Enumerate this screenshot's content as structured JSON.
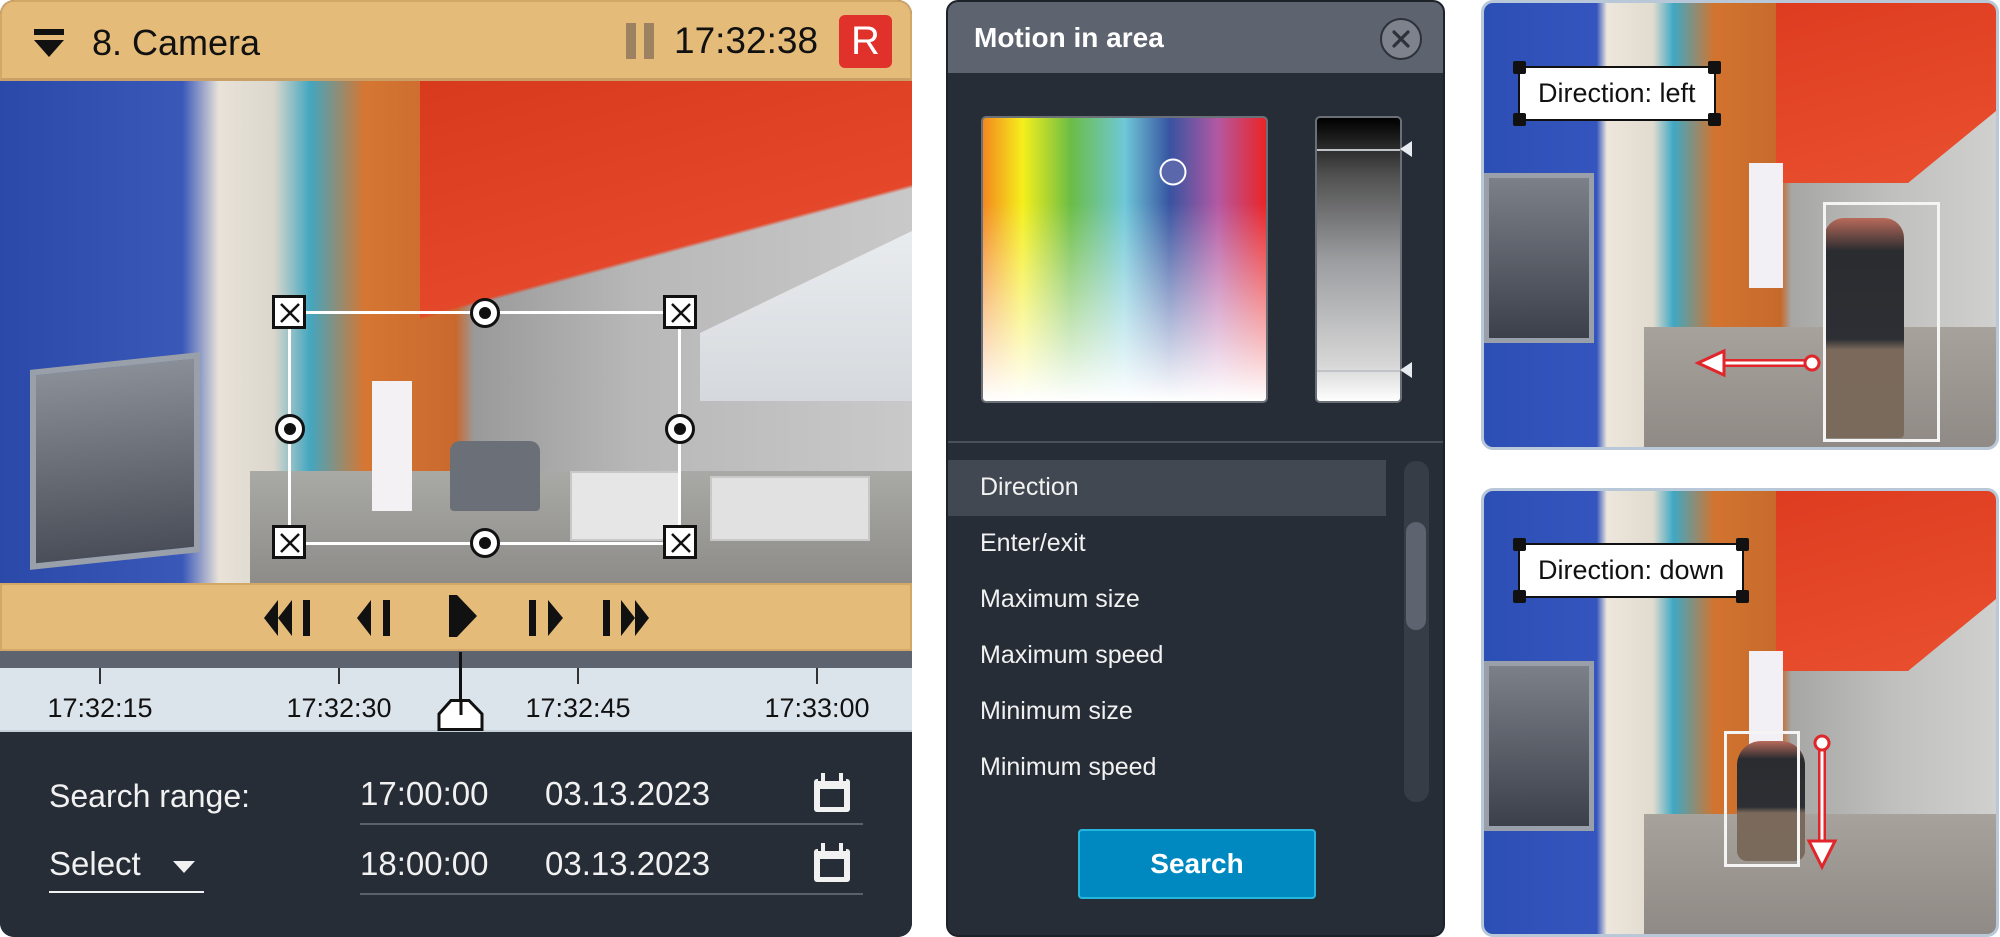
{
  "camera": {
    "title": "8. Camera",
    "clock": "17:32:38",
    "record_badge": "R",
    "status_icon": "pause-icon",
    "controls": [
      {
        "name": "skip-to-start",
        "icon": "skip-back-icon"
      },
      {
        "name": "step-back",
        "icon": "step-back-icon"
      },
      {
        "name": "play",
        "icon": "play-icon"
      },
      {
        "name": "step-forward",
        "icon": "step-forward-icon"
      },
      {
        "name": "skip-to-end",
        "icon": "skip-forward-icon"
      }
    ],
    "timeline": {
      "ticks": [
        "17:32:15",
        "17:32:30",
        "17:32:45",
        "17:33:00"
      ],
      "playhead_time": "17:32:38"
    },
    "search_range": {
      "label": "Search range:",
      "select_label": "Select",
      "from": {
        "time": "17:00:00",
        "date": "03.13.2023"
      },
      "to": {
        "time": "18:00:00",
        "date": "03.13.2023"
      }
    }
  },
  "dialog": {
    "title": "Motion in area",
    "close_icon": "close-icon",
    "color_picker": {
      "selected_color": "#5b67ab",
      "brightness_range": {
        "upper": 0.11,
        "lower": 0.89
      }
    },
    "options": [
      {
        "label": "Direction",
        "selected": true
      },
      {
        "label": "Enter/exit",
        "selected": false
      },
      {
        "label": "Maximum size",
        "selected": false
      },
      {
        "label": "Maximum speed",
        "selected": false
      },
      {
        "label": "Minimum size",
        "selected": false
      },
      {
        "label": "Minimum speed",
        "selected": false
      }
    ],
    "scroll": {
      "position_fraction": 0.18,
      "visible_fraction": 0.32
    },
    "search_label": "Search"
  },
  "examples": [
    {
      "label": "Direction: left",
      "direction": "left"
    },
    {
      "label": "Direction: down",
      "direction": "down"
    }
  ],
  "colors": {
    "camera_bar": "#e4bb78",
    "record": "#e0312a",
    "dialog_bg": "#272d36",
    "dialog_header": "#5e6370",
    "search_button": "#0089c1",
    "motion_arrow": "#e0262b"
  }
}
